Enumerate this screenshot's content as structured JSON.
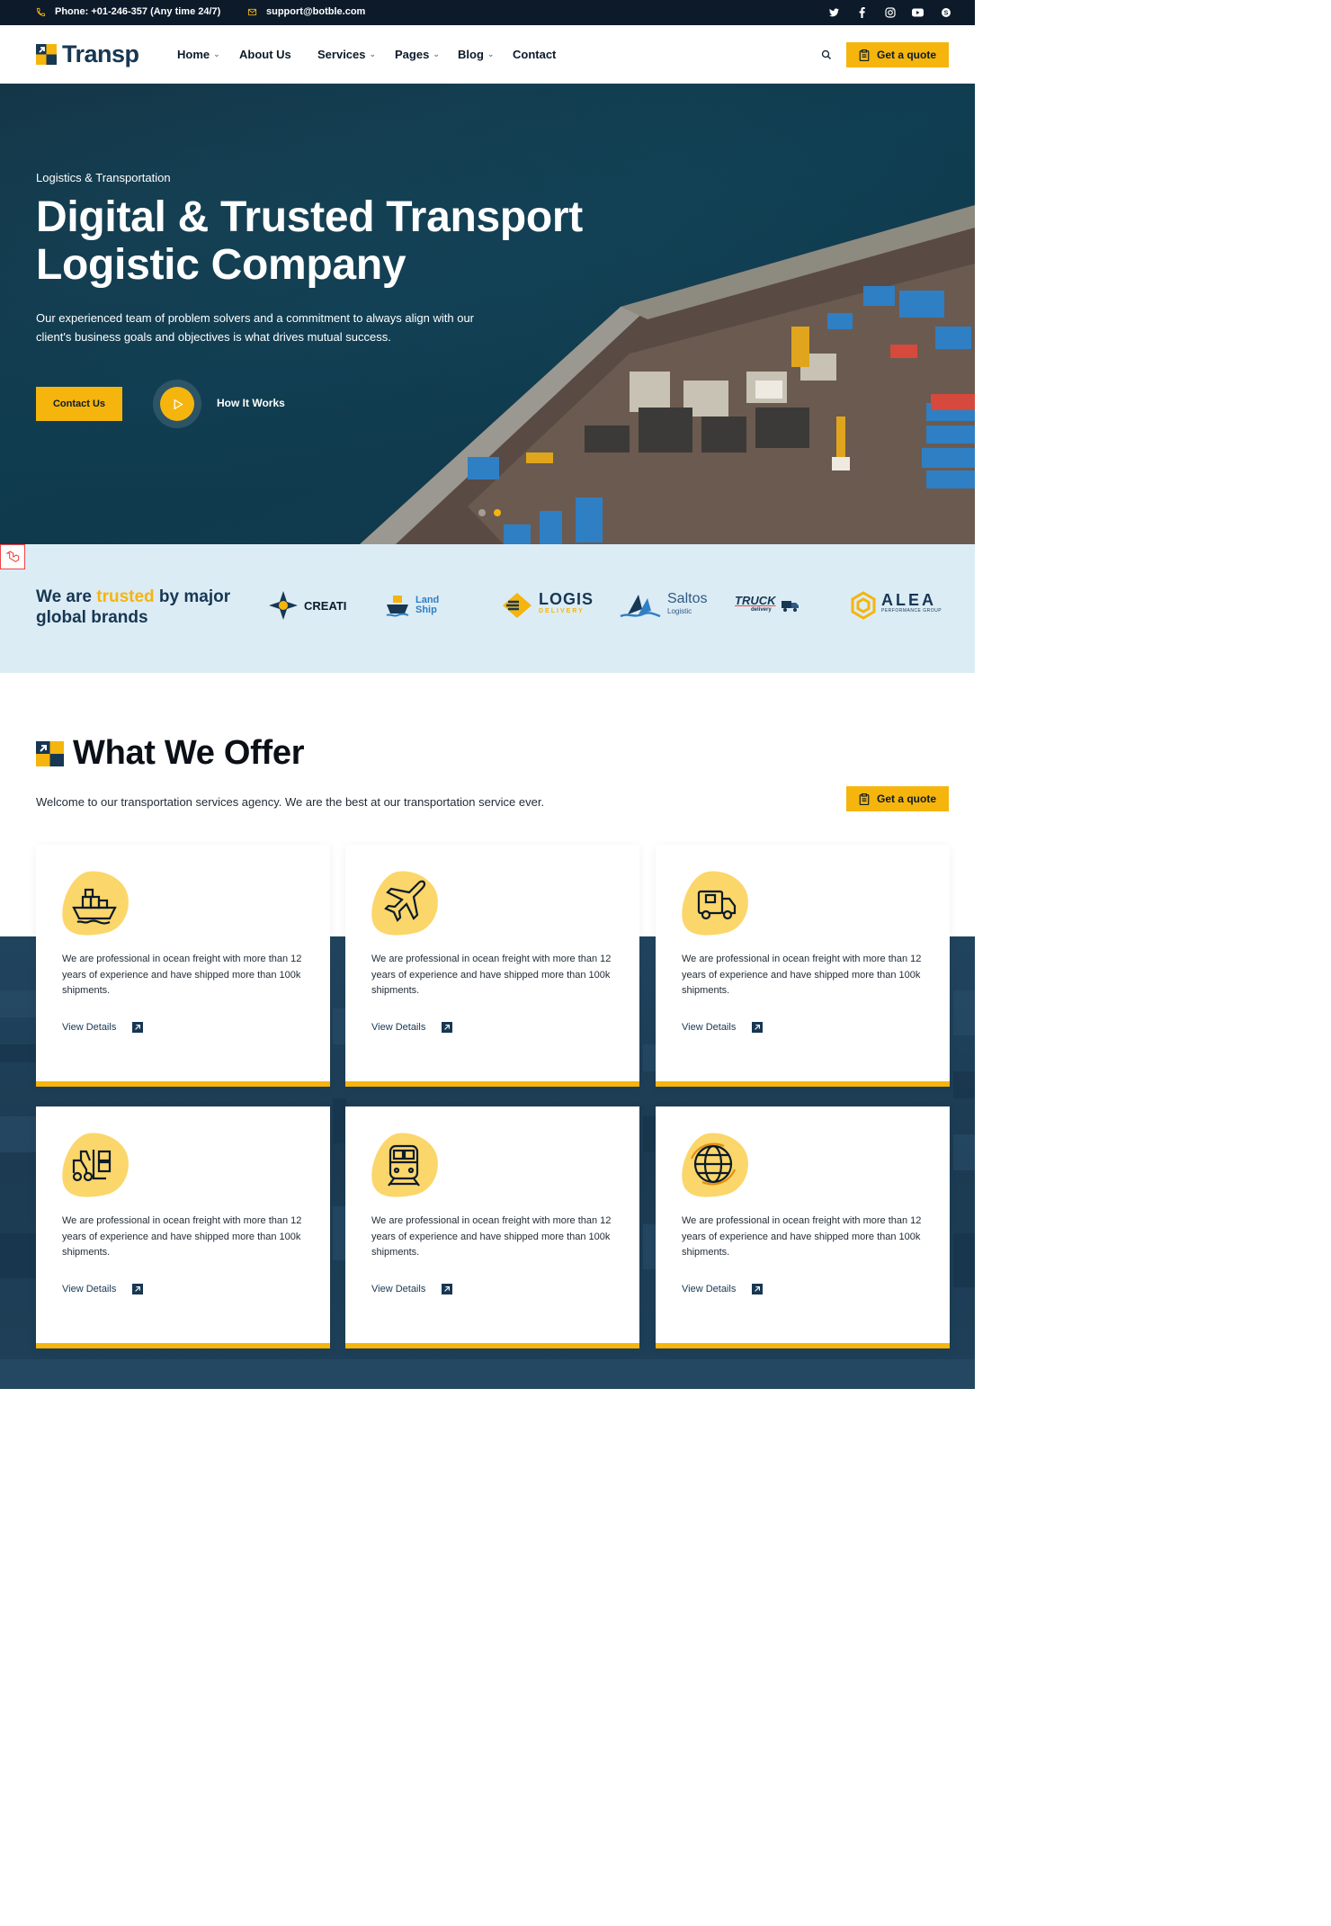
{
  "topbar": {
    "phone": "Phone: +01-246-357 (Any time 24/7)",
    "email": "support@botble.com",
    "social": [
      "twitter-icon",
      "facebook-icon",
      "instagram-icon",
      "youtube-icon",
      "skype-icon"
    ]
  },
  "header": {
    "logo_text": "Transp",
    "nav": [
      {
        "label": "Home",
        "dropdown": true
      },
      {
        "label": "About Us",
        "dropdown": false
      },
      {
        "label": "Services",
        "dropdown": true
      },
      {
        "label": "Pages",
        "dropdown": true
      },
      {
        "label": "Blog",
        "dropdown": true
      },
      {
        "label": "Contact",
        "dropdown": false
      }
    ],
    "quote_label": "Get a quote"
  },
  "hero": {
    "eyebrow": "Logistics & Transportation",
    "title": "Digital & Trusted Transport Logistic Company",
    "description": "Our experienced team of problem solvers and a commitment to always align with our client's business goals and objectives is what drives mutual success.",
    "contact_label": "Contact Us",
    "how_label": "How It Works",
    "slide_count": 2,
    "active_slide": 2
  },
  "brands": {
    "heading_pre": "We are ",
    "heading_highlight": "trusted",
    "heading_post": " by major global brands",
    "items": [
      {
        "name": "CREATI"
      },
      {
        "name": "Land",
        "sub": "Ship"
      },
      {
        "name": "LOGIS",
        "sub": "DELIVERY"
      },
      {
        "name": "Saltos",
        "sub": "Logistic"
      },
      {
        "name": "TRUCK",
        "sub": "delivery"
      },
      {
        "name": "ALEA",
        "sub": "PERFORMANCE GROUP"
      }
    ]
  },
  "offer": {
    "title": "What We Offer",
    "description": "Welcome to our transportation services agency. We are the best at our transportation service ever.",
    "quote_label": "Get a quote",
    "cards": [
      {
        "icon": "cargo-ship-icon",
        "text": "We are professional in ocean freight with more than 12 years of experience and have shipped more than 100k shipments.",
        "link": "View Details"
      },
      {
        "icon": "airplane-icon",
        "text": "We are professional in ocean freight with more than 12 years of experience and have shipped more than 100k shipments.",
        "link": "View Details"
      },
      {
        "icon": "delivery-truck-icon",
        "text": "We are professional in ocean freight with more than 12 years of experience and have shipped more than 100k shipments.",
        "link": "View Details"
      },
      {
        "icon": "forklift-icon",
        "text": "We are professional in ocean freight with more than 12 years of experience and have shipped more than 100k shipments.",
        "link": "View Details"
      },
      {
        "icon": "train-icon",
        "text": "We are professional in ocean freight with more than 12 years of experience and have shipped more than 100k shipments.",
        "link": "View Details"
      },
      {
        "icon": "globe-icon",
        "text": "We are professional in ocean freight with more than 12 years of experience and have shipped more than 100k shipments.",
        "link": "View Details"
      }
    ]
  },
  "colors": {
    "accent": "#f5b50d",
    "navy": "#173753",
    "dark": "#0c1a2a",
    "brand_band": "#dcecf5"
  }
}
